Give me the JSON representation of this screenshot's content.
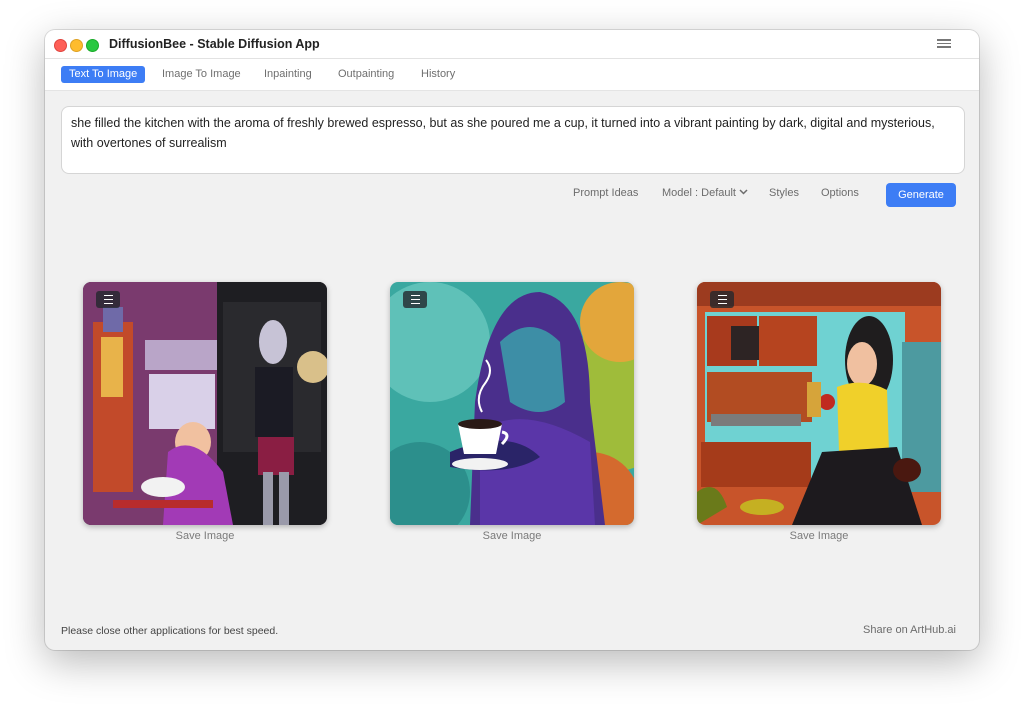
{
  "window": {
    "title": "DiffusionBee - Stable Diffusion App"
  },
  "tabs": [
    {
      "label": "Text To Image",
      "active": true
    },
    {
      "label": "Image To Image",
      "active": false
    },
    {
      "label": "Inpainting",
      "active": false
    },
    {
      "label": "Outpainting",
      "active": false
    },
    {
      "label": "History",
      "active": false
    }
  ],
  "prompt": {
    "value": "she filled the kitchen with the aroma of freshly brewed espresso, but as she poured me a cup, it turned into a vibrant painting by dark, digital and mysterious, with overtones of surrealism"
  },
  "toolbar": {
    "prompt_ideas": "Prompt Ideas",
    "model": "Model : Default",
    "styles": "Styles",
    "options": "Options",
    "generate": "Generate"
  },
  "images": [
    {
      "save_label": "Save Image",
      "menu_icon": "menu-icon"
    },
    {
      "save_label": "Save Image",
      "menu_icon": "menu-icon"
    },
    {
      "save_label": "Save Image",
      "menu_icon": "menu-icon"
    }
  ],
  "footer": {
    "hint": "Please close other applications for best speed.",
    "share": "Share on ArtHub.ai"
  },
  "colors": {
    "accent": "#3d7df5",
    "background": "#f1f1f1"
  }
}
